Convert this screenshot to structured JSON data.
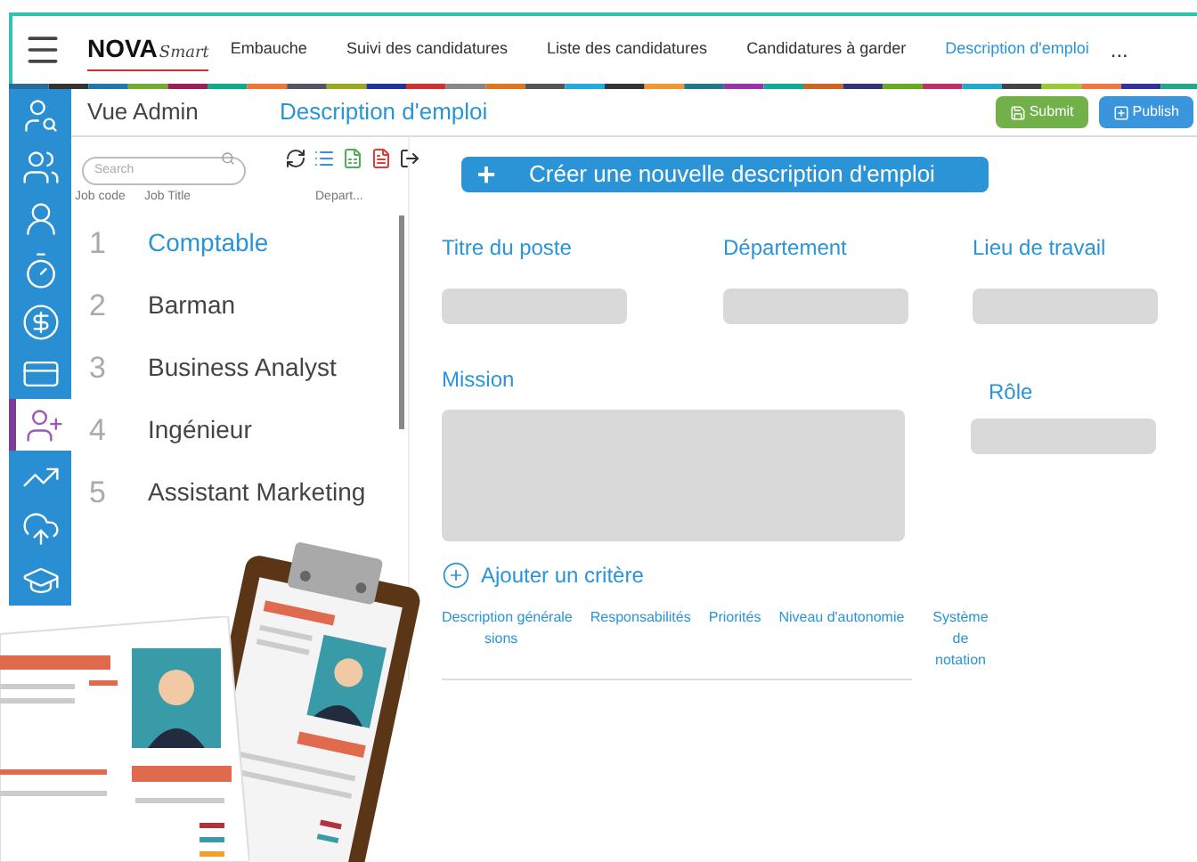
{
  "brand": {
    "name": "NOVA",
    "tagline": "Smart"
  },
  "nav": [
    {
      "label": "Embauche",
      "selected": false
    },
    {
      "label": "Suivi des candidatures",
      "selected": false
    },
    {
      "label": "Liste des candidatures",
      "selected": false
    },
    {
      "label": "Candidatures à garder",
      "selected": false
    },
    {
      "label": "Description d'emploi",
      "selected": true
    }
  ],
  "nav_more": "...",
  "sidebar": [
    {
      "kind": "search",
      "selected": false
    },
    {
      "kind": "team",
      "selected": false
    },
    {
      "kind": "badge",
      "selected": false
    },
    {
      "kind": "timer",
      "selected": false
    },
    {
      "kind": "dollar",
      "selected": false
    },
    {
      "kind": "cards",
      "selected": false
    },
    {
      "kind": "adduser",
      "selected": true
    },
    {
      "kind": "growth",
      "selected": false
    },
    {
      "kind": "upload",
      "selected": false
    },
    {
      "kind": "graduation",
      "selected": false
    }
  ],
  "header": {
    "view": "Vue Admin",
    "title": "Description d'emploi",
    "buttons": [
      {
        "label": "Submit",
        "kind": "submit"
      },
      {
        "label": "Publish",
        "kind": "publish"
      }
    ]
  },
  "search": {
    "placeholder": "Search"
  },
  "create_button": {
    "icon": "+",
    "label": "Créer une nouvelle description d'emploi"
  },
  "table": {
    "columns": [
      "Job code",
      "Job Title",
      "Depart..."
    ],
    "rows": [
      {
        "code": "1",
        "title": "Comptable",
        "selected": true
      },
      {
        "code": "2",
        "title": "Barman",
        "selected": false
      },
      {
        "code": "3",
        "title": "Business Analyst",
        "selected": false
      },
      {
        "code": "4",
        "title": "Ingénieur",
        "selected": false
      },
      {
        "code": "5",
        "title": "Assistant Marketing",
        "selected": false
      }
    ]
  },
  "form": {
    "fields": [
      {
        "label": "Titre du poste"
      },
      {
        "label": "Département"
      },
      {
        "label": "Lieu de travail"
      }
    ],
    "mission": {
      "label": "Mission"
    },
    "role": {
      "label": "Rôle"
    },
    "add_criterion": "Ajouter un critère",
    "tabs": [
      {
        "label": "Description générale",
        "label_rest": "sions"
      },
      {
        "label": "Responsabilités"
      },
      {
        "label": "Priorités"
      },
      {
        "label": "Niveau d'autonomie"
      },
      {
        "label": "Système de notation"
      }
    ]
  }
}
